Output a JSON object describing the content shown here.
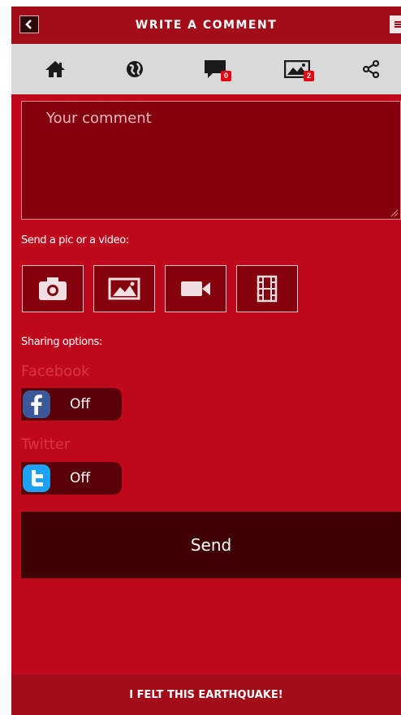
{
  "header": {
    "title": "WRITE A COMMENT"
  },
  "nav": {
    "comments_count": "0",
    "photos_count": "2"
  },
  "comment": {
    "placeholder": "Your comment"
  },
  "media": {
    "label": "Send a pic or a video:"
  },
  "sharing": {
    "label": "Sharing options:",
    "facebook": {
      "label": "Facebook",
      "state": "Off"
    },
    "twitter": {
      "label": "Twitter",
      "state": "Off"
    }
  },
  "send": {
    "label": "Send"
  },
  "footer": {
    "label": "I FELT THIS EARTHQUAKE!"
  },
  "colors": {
    "background": "#c0081c",
    "header": "#a30d1a",
    "nav": "#d9d9d9",
    "send_button": "#3e0003",
    "facebook": "#3b5998",
    "twitter": "#1da1f2"
  }
}
